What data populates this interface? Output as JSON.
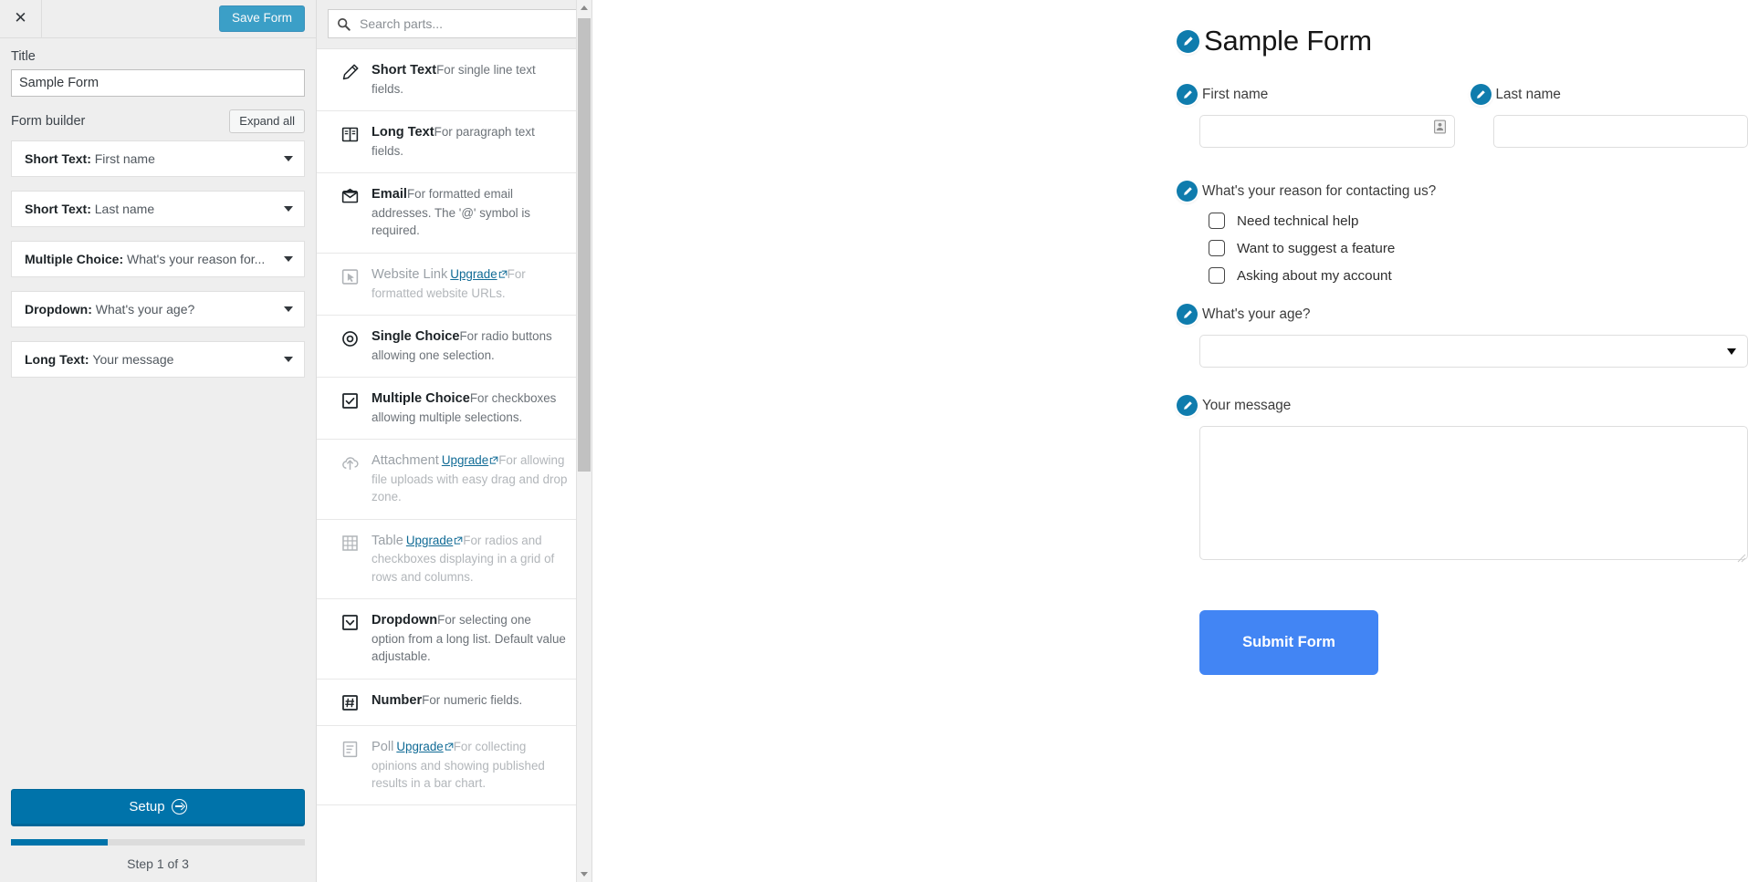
{
  "left_panel": {
    "close_label": "✕",
    "save_button": "Save Form",
    "title_label": "Title",
    "title_value": "Sample Form",
    "builder_label": "Form builder",
    "expand_all_button": "Expand all",
    "builder_items": [
      {
        "type": "Short Text: ",
        "name": "First name"
      },
      {
        "type": "Short Text: ",
        "name": "Last name"
      },
      {
        "type": "Multiple Choice: ",
        "name": "What's your reason for..."
      },
      {
        "type": "Dropdown: ",
        "name": "What's your age?"
      },
      {
        "type": "Long Text: ",
        "name": "Your message"
      }
    ],
    "setup_button": "Setup",
    "progress_percent": 33,
    "step_text": "Step 1 of 3"
  },
  "parts_panel": {
    "search_placeholder": "Search parts...",
    "search_value": "",
    "upgrade_label": "Upgrade",
    "items": [
      {
        "icon": "pencil-icon",
        "title": "Short Text",
        "desc": "For single line text fields.",
        "disabled": false,
        "upgrade": false
      },
      {
        "icon": "book-icon",
        "title": "Long Text",
        "desc": "For paragraph text fields.",
        "disabled": false,
        "upgrade": false
      },
      {
        "icon": "envelope-icon",
        "title": "Email",
        "desc": "For formatted email addresses. The '@' symbol is required.",
        "disabled": false,
        "upgrade": false
      },
      {
        "icon": "cursor-box-icon",
        "title": "Website Link",
        "desc": "For formatted website URLs.",
        "disabled": true,
        "upgrade": true
      },
      {
        "icon": "radio-icon",
        "title": "Single Choice",
        "desc": "For radio buttons allowing one selection.",
        "disabled": false,
        "upgrade": false
      },
      {
        "icon": "checkbox-icon",
        "title": "Multiple Choice",
        "desc": "For checkboxes allowing multiple selections.",
        "disabled": false,
        "upgrade": false
      },
      {
        "icon": "cloud-upload-icon",
        "title": "Attachment",
        "desc": "For allowing file uploads with easy drag and drop zone.",
        "disabled": true,
        "upgrade": true
      },
      {
        "icon": "grid-icon",
        "title": "Table",
        "desc": "For radios and checkboxes displaying in a grid of rows and columns.",
        "disabled": true,
        "upgrade": true
      },
      {
        "icon": "dropdown-icon",
        "title": "Dropdown",
        "desc": "For selecting one option from a long list. Default value adjustable.",
        "disabled": false,
        "upgrade": false
      },
      {
        "icon": "hash-icon",
        "title": "Number",
        "desc": "For numeric fields.",
        "disabled": false,
        "upgrade": false
      },
      {
        "icon": "poll-icon",
        "title": "Poll",
        "desc": "For collecting opinions and showing published results in a bar chart.",
        "disabled": true,
        "upgrade": true
      }
    ]
  },
  "preview": {
    "form_title": "Sample Form",
    "first_name_label": "First name",
    "first_name_value": "",
    "last_name_label": "Last name",
    "last_name_value": "",
    "reason_label": "What's your reason for contacting us?",
    "reason_options": [
      "Need technical help",
      "Want to suggest a feature",
      "Asking about my account"
    ],
    "age_label": "What's your age?",
    "age_value": "",
    "message_label": "Your message",
    "message_value": "",
    "submit_button": "Submit Form"
  },
  "colors": {
    "accent_blue": "#0085ba",
    "setup_blue": "#0073aa",
    "submit_blue": "#4285f4",
    "badge_blue": "#0f7cad",
    "link_blue": "#0f6a95"
  }
}
